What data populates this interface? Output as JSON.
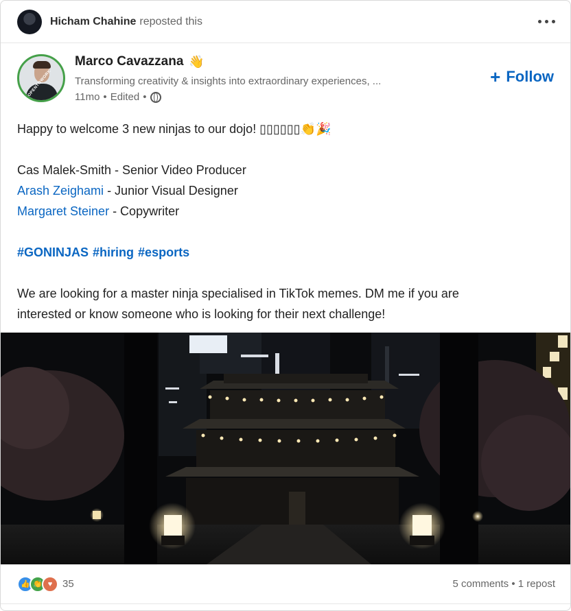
{
  "repost": {
    "name": "Hicham Chahine",
    "text": "reposted this"
  },
  "author": {
    "name": "Marco Cavazzana",
    "name_emoji": "👋",
    "headline": "Transforming creativity & insights into extraordinary experiences, ...",
    "time": "11mo",
    "edited": "Edited",
    "separator": "•",
    "avatar_ring_text": "#OPENTOWORK"
  },
  "follow": {
    "label": "Follow"
  },
  "post": {
    "intro": "Happy to welcome 3 new ninjas to our dojo! ",
    "intro_emojis": "▯▯▯▯▯▯👏🎉",
    "hires": [
      {
        "name": "Cas Malek-Smith",
        "role": " - Senior Video Producer",
        "linked": false
      },
      {
        "name": "Arash Zeighami",
        "role": " - Junior Visual Designer",
        "linked": true
      },
      {
        "name": "Margaret Steiner",
        "role": " - Copywriter",
        "linked": true
      }
    ],
    "hashtags": [
      "#GONINJAS",
      "#hiring",
      "#esports"
    ],
    "closing_line1": "We are looking for a master ninja specialised in TikTok memes. DM me if you are",
    "closing_line2": "interested or know someone who is looking for their next challenge!"
  },
  "social": {
    "reaction_count": "35",
    "comments": "5 comments",
    "separator": "•",
    "reposts": "1 repost"
  },
  "colors": {
    "accent": "#0a66c2",
    "opentowork_ring": "#45a049"
  }
}
